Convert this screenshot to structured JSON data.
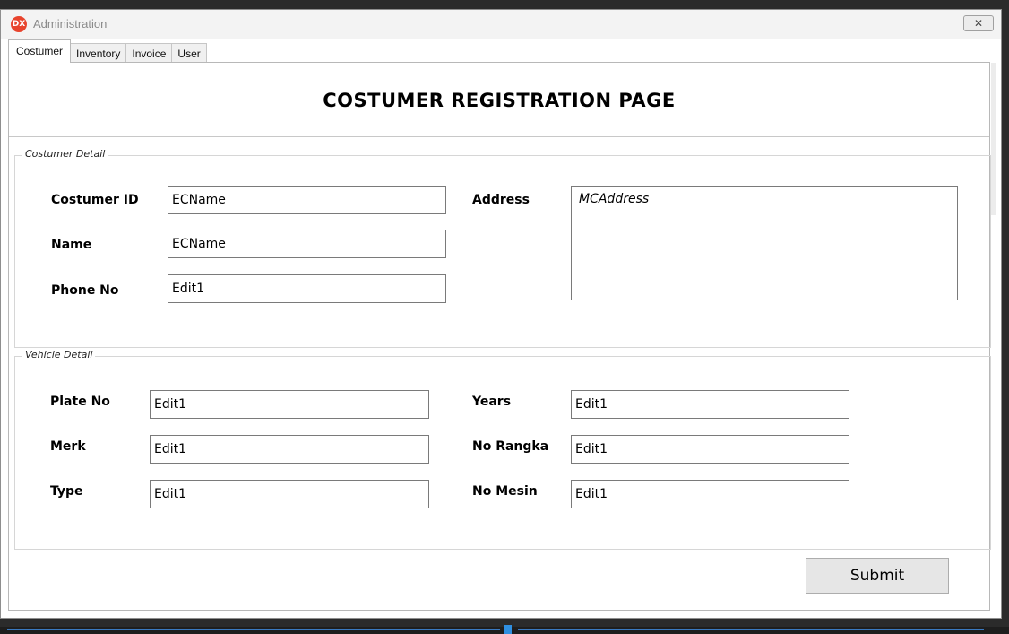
{
  "window": {
    "title": "Administration",
    "app_icon_text": "DX",
    "close_glyph": "✕"
  },
  "tabs": [
    {
      "label": "Costumer",
      "active": true
    },
    {
      "label": "Inventory",
      "active": false
    },
    {
      "label": "Invoice",
      "active": false
    },
    {
      "label": "User",
      "active": false
    }
  ],
  "page": {
    "title": "COSTUMER REGISTRATION PAGE"
  },
  "costumer_detail": {
    "caption": "Costumer Detail",
    "costumer_id": {
      "label": "Costumer ID",
      "value": "ECName"
    },
    "name": {
      "label": "Name",
      "value": "ECName"
    },
    "phone_no": {
      "label": "Phone No",
      "value": "Edit1"
    },
    "address": {
      "label": "Address",
      "value": "MCAddress"
    }
  },
  "vehicle_detail": {
    "caption": "Vehicle Detail",
    "plate_no": {
      "label": "Plate No",
      "value": "Edit1"
    },
    "merk": {
      "label": "Merk",
      "value": "Edit1"
    },
    "type": {
      "label": "Type",
      "value": "Edit1"
    },
    "years": {
      "label": "Years",
      "value": "Edit1"
    },
    "no_rangka": {
      "label": "No Rangka",
      "value": "Edit1"
    },
    "no_mesin": {
      "label": "No Mesin",
      "value": "Edit1"
    }
  },
  "actions": {
    "submit_label": "Submit"
  },
  "colors": {
    "app_icon": "#e8442d",
    "accent_bar": "#3a79c0"
  }
}
